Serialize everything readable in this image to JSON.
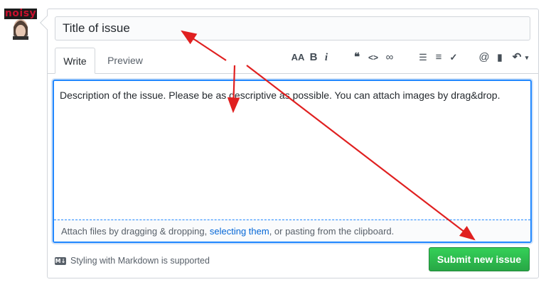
{
  "avatar": {
    "badge_text": "noisy"
  },
  "title_field": {
    "value": "Title of issue"
  },
  "tabs": [
    {
      "label": "Write"
    },
    {
      "label": "Preview"
    }
  ],
  "toolbar": {
    "items": [
      {
        "name": "header-icon",
        "glyph": "AA"
      },
      {
        "name": "bold-icon",
        "glyph": "B"
      },
      {
        "name": "italic-icon",
        "glyph": "i"
      },
      {
        "name": "quote-icon",
        "glyph": "❝"
      },
      {
        "name": "code-icon",
        "glyph": "<>"
      },
      {
        "name": "link-icon",
        "glyph": "∞"
      },
      {
        "name": "unordered-list-icon",
        "glyph": "☰"
      },
      {
        "name": "ordered-list-icon",
        "glyph": "≡"
      },
      {
        "name": "task-list-icon",
        "glyph": "✓"
      },
      {
        "name": "mention-icon",
        "glyph": "@"
      },
      {
        "name": "bookmark-icon",
        "glyph": "▮"
      },
      {
        "name": "reply-icon",
        "glyph": "↶"
      }
    ]
  },
  "editor": {
    "body": "Description of the issue. Please be as descriptive as possible. You can attach images by drag&drop.",
    "attach_prefix": "Attach files by dragging & dropping, ",
    "attach_link": "selecting them",
    "attach_suffix": ", or pasting from the clipboard."
  },
  "footer": {
    "markdown_note": "Styling with Markdown is supported"
  },
  "submit_button": {
    "label": "Submit new issue"
  },
  "colors": {
    "accent_blue": "#2188ff",
    "link_blue": "#0366d6",
    "submit_green": "#28a745",
    "annotation_red": "#e02020"
  }
}
